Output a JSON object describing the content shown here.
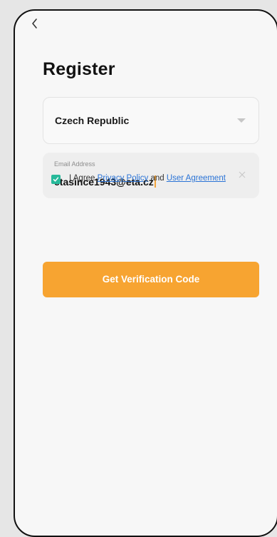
{
  "header": {
    "title": "Register"
  },
  "country": {
    "label": "Czech Republic"
  },
  "email": {
    "floating_label": "Email Address",
    "value": "etasince1943@eta.cz"
  },
  "agreement": {
    "checked": true,
    "prefix": "I Agree",
    "privacy_link": "Privacy Policy",
    "and": "and",
    "user_agreement_link": "User Agreement"
  },
  "cta": {
    "label": "Get Verification Code"
  },
  "colors": {
    "accent": "#f7a431",
    "checkbox": "#27b99a",
    "link": "#2a73d6"
  },
  "icons": {
    "back": "back-arrow-icon",
    "dropdown": "caret-down-icon",
    "clear": "clear-x-icon",
    "check": "check-icon"
  }
}
